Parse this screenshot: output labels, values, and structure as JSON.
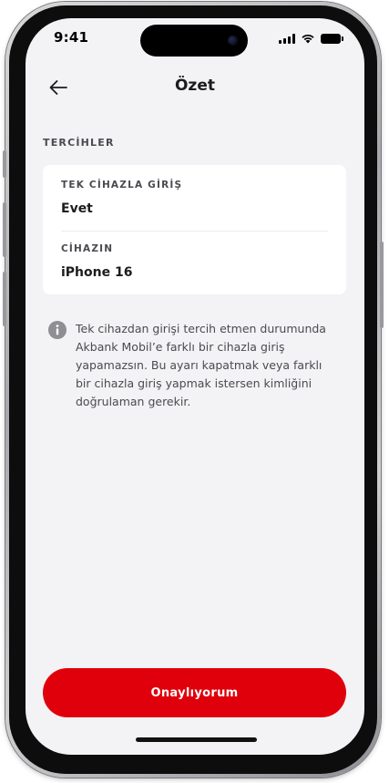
{
  "status_bar": {
    "time": "9:41"
  },
  "nav": {
    "back_icon": "arrow-left-icon",
    "title": "Özet"
  },
  "preferences": {
    "section_title": "TERCİHLER",
    "rows": [
      {
        "label": "TEK CİHAZLA GİRİŞ",
        "value": "Evet"
      },
      {
        "label": "CİHAZIN",
        "value": "iPhone 16"
      }
    ]
  },
  "info": {
    "icon": "info-icon",
    "text": "Tek cihazdan girişi tercih etmen durumunda Akbank Mobil’e farklı bir cihazla giriş yapamazsın. Bu ayarı kapatmak veya farklı bir cihazla giriş yapmak istersen kimliğini doğrulaman gerekir."
  },
  "actions": {
    "confirm_label": "Onaylıyorum"
  },
  "colors": {
    "accent": "#e0000b",
    "background": "#f3f3f5",
    "card": "#ffffff",
    "text_primary": "#1c1c1e",
    "text_secondary": "#4a4a50",
    "info_icon": "#8e8e93"
  }
}
